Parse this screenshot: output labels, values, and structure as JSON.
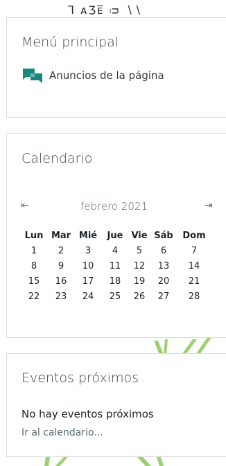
{
  "colors": {
    "accent": "#188a7b",
    "link": "#2b5f94",
    "muted": "#8d949a"
  },
  "top_fragment": "⅂ ᴀӠᴇ̅ ᴞ   ∖∖",
  "menu": {
    "title": "Menú principal",
    "items": [
      {
        "label": "Anuncios de la página",
        "icon": "chat-icon"
      }
    ]
  },
  "calendar": {
    "title": "Calendario",
    "prev_icon": "prev-month-icon",
    "next_icon": "next-month-icon",
    "month_label": "febrero 2021",
    "weekdays": [
      "Lun",
      "Mar",
      "Mié",
      "Jue",
      "Vie",
      "Sáb",
      "Dom"
    ],
    "weeks": [
      [
        "1",
        "2",
        "3",
        "4",
        "5",
        "6",
        "7"
      ],
      [
        "8",
        "9",
        "10",
        "11",
        "12",
        "13",
        "14"
      ],
      [
        "15",
        "16",
        "17",
        "18",
        "19",
        "20",
        "21"
      ],
      [
        "22",
        "23",
        "24",
        "25",
        "26",
        "27",
        "28"
      ]
    ],
    "today": "22"
  },
  "events": {
    "title": "Eventos próximos",
    "empty_message": "No hay eventos próximos",
    "calendar_link": "Ir al calendario..."
  }
}
